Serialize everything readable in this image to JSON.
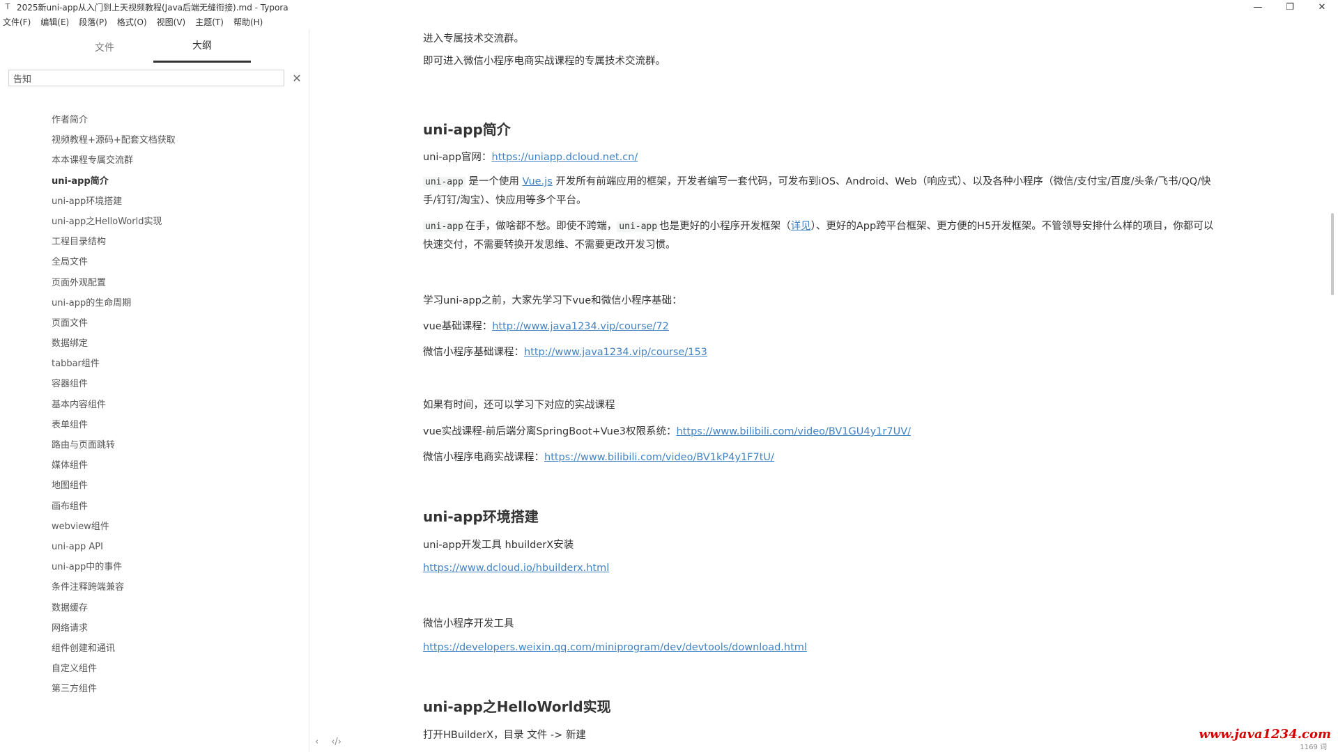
{
  "window": {
    "title": "2025新uni-app从入门到上天视频教程(Java后端无缝衔接).md - Typora",
    "controls": {
      "minimize": "—",
      "maximize": "❐",
      "close": "✕"
    }
  },
  "menu": [
    "文件(F)",
    "编辑(E)",
    "段落(P)",
    "格式(O)",
    "视图(V)",
    "主题(T)",
    "帮助(H)"
  ],
  "sidebar": {
    "tabs": [
      {
        "label": "文件"
      },
      {
        "label": "大纲"
      }
    ],
    "search_value": "告知",
    "clear_icon": "✕",
    "outline": [
      "作者简介",
      "视频教程+源码+配套文档获取",
      "本本课程专属交流群",
      "uni-app简介",
      "uni-app环境搭建",
      "uni-app之HelloWorld实现",
      "工程目录结构",
      "全局文件",
      "页面外观配置",
      "uni-app的生命周期",
      "页面文件",
      "数据绑定",
      "tabbar组件",
      "容器组件",
      "基本内容组件",
      "表单组件",
      "路由与页面跳转",
      "媒体组件",
      "地图组件",
      "画布组件",
      "webview组件",
      "uni-app API",
      "uni-app中的事件",
      "条件注释跨端兼容",
      "数据缓存",
      "网络请求",
      "组件创建和通讯",
      "自定义组件",
      "第三方组件"
    ],
    "footer": {
      "left": "‹",
      "right": "‹/›"
    }
  },
  "doc": {
    "p1": "进入专属技术交流群。",
    "p2": "即可进入微信小程序电商实战课程的专属技术交流群。",
    "h_intro": "uni-app简介",
    "site_label": "uni-app官网：",
    "site_url": "https://uniapp.dcloud.net.cn/",
    "intro_code": "uni-app",
    "intro_t1": " 是一个使用 ",
    "intro_vue": "Vue.js",
    "intro_t2": " 开发所有前端应用的框架，开发者编写一套代码，可发布到iOS、Android、Web（响应式）、以及各种小程序（微信/支付宝/百度/头条/飞书/QQ/快手/钉钉/淘宝）、快应用等多个平台。",
    "p4_code1": "uni-app",
    "p4_t1": "在手，做啥都不愁。即使不跨端，",
    "p4_code2": "uni-app",
    "p4_t2": "也是更好的小程序开发框架（",
    "p4_link": "详见",
    "p4_t3": "）、更好的App跨平台框架、更方便的H5开发框架。不管领导安排什么样的项目，你都可以快速交付，不需要转换开发思维、不需要更改开发习惯。",
    "p5": "学习uni-app之前，大家先学习下vue和微信小程序基础：",
    "vue_label": "vue基础课程：",
    "vue_url": "http://www.java1234.vip/course/72",
    "wx_label": "微信小程序基础课程：",
    "wx_url": "http://www.java1234.vip/course/153",
    "p8": "如果有时间，还可以学习下对应的实战课程",
    "vue_real_label": "vue实战课程-前后端分离SpringBoot+Vue3权限系统：",
    "vue_real_url": "https://www.bilibili.com/video/BV1GU4y1r7UV/",
    "wx_real_label": "微信小程序电商实战课程：",
    "wx_real_url": "https://www.bilibili.com/video/BV1kP4y1F7tU/",
    "h_env": "uni-app环境搭建",
    "hbx_text": "uni-app开发工具 hbuilderX安装",
    "hbx_url": "https://www.dcloud.io/hbuilderx.html",
    "wxtool_text": "微信小程序开发工具",
    "wxtool_url": "https://developers.weixin.qq.com/miniprogram/dev/devtools/download.html",
    "h_hello": "uni-app之HelloWorld实现",
    "hello_text": "打开HBuilderX，目录 文件 -> 新建"
  },
  "watermark": "www.java1234.com",
  "status": {
    "word_count": "1169 词"
  }
}
